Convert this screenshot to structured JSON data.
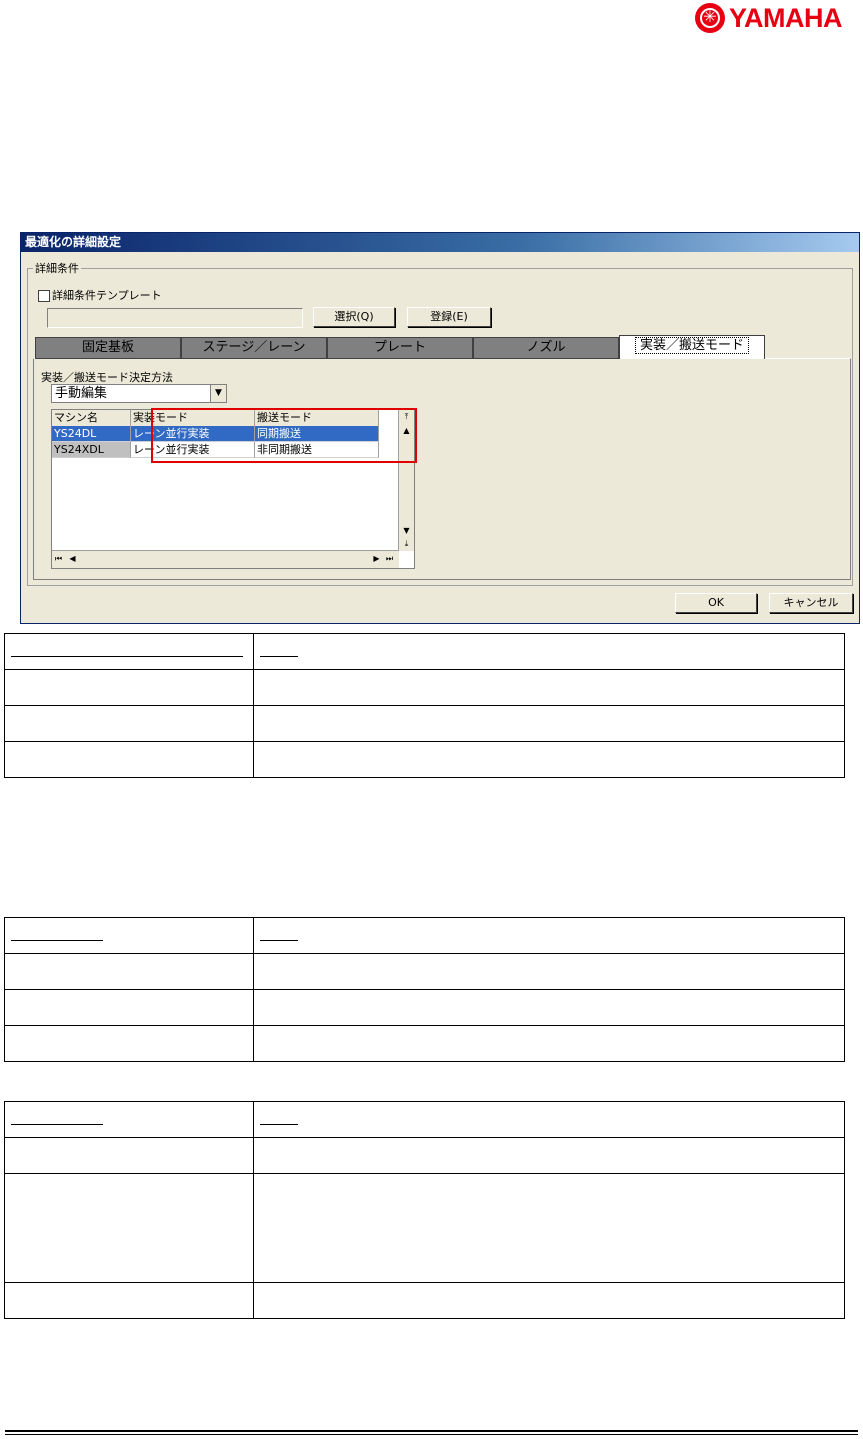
{
  "logo": {
    "text": "YAMAHA",
    "color": "#e60012"
  },
  "dialog": {
    "title": "最適化の詳細設定",
    "group_label": "詳細条件",
    "template_checkbox_label": "詳細条件テンプレート",
    "template_value": "",
    "select_button": "選択(Q)",
    "register_button": "登録(E)",
    "tabs": [
      "固定基板",
      "ステージ／レーン",
      "プレート",
      "ノズル",
      "実装／搬送モード"
    ],
    "active_tab": "実装／搬送モード",
    "method_label": "実装／搬送モード決定方法",
    "method_value": "手動編集",
    "grid": {
      "columns": [
        "マシン名",
        "実装モード",
        "搬送モード"
      ],
      "rows": [
        [
          "YS24DL",
          "レーン並行実装",
          "同期搬送"
        ],
        [
          "YS24XDL",
          "レーン並行実装",
          "非同期搬送"
        ]
      ]
    },
    "ok_button": "OK",
    "cancel_button": "キャンセル",
    "highlight_color": "#e00000",
    "selection_color": "#316ac5"
  }
}
